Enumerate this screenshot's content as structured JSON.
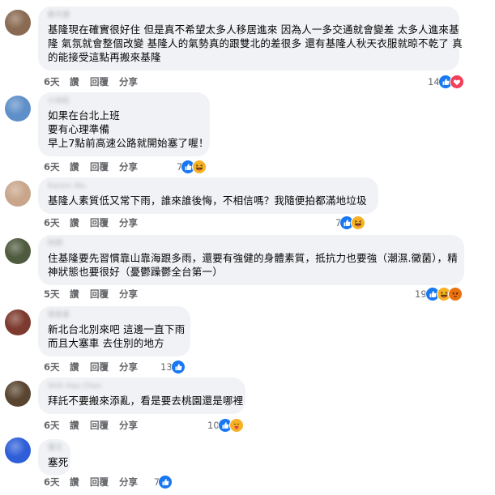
{
  "comments": [
    {
      "author": "鄭天康",
      "avatar_color": "#8a6a52",
      "lines": [
        "基隆現在確實很好住 但是真不希望太多人移居進來 因為人一多交通就會變差 太多人進來基",
        "隆 氣氛就會整個改變 基隆人的氣勢真的跟雙北的差很多 還有基隆人秋天衣服就晾不乾了 真",
        "的能接受這點再搬來基隆"
      ],
      "time": "6天",
      "like": "讚",
      "reply": "回覆",
      "share": "分享",
      "reaction_count": "14",
      "reactions": [
        "like",
        "love"
      ]
    },
    {
      "author": "小米粒",
      "avatar_color": "#5f8fc9",
      "lines": [
        "如果在台北上班",
        "要有心理準備",
        "早上7點前高速公路就開始塞了喔！"
      ],
      "time": "6天",
      "like": "讚",
      "reply": "回覆",
      "share": "分享",
      "reaction_count": "7",
      "reactions": [
        "like",
        "haha"
      ]
    },
    {
      "author": "Kasion Wu",
      "avatar_color": "#c9a68b",
      "lines": [
        "基隆人素質低又常下雨，誰來誰後悔，不相信嗎？我隨便拍都滿地垃圾"
      ],
      "time": "6天",
      "like": "讚",
      "reply": "回覆",
      "share": "分享",
      "reaction_count": "7",
      "reactions": [
        "like",
        "haha"
      ]
    },
    {
      "author": "阿明",
      "avatar_color": "#4f5b3e",
      "lines": [
        "住基隆要先習慣靠山靠海跟多雨，還要有強健的身體素質，抵抗力也要強（潮濕.黴菌），精",
        "神狀態也要很好（憂鬱躁鬱全台第一）"
      ],
      "time": "5天",
      "like": "讚",
      "reply": "回覆",
      "share": "分享",
      "reaction_count": "19",
      "reactions": [
        "like",
        "haha",
        "angry"
      ]
    },
    {
      "author": "張家豪",
      "avatar_color": "#7d3a2e",
      "lines": [
        "新北台北別來吧 這邊一直下雨",
        "而且大塞車 去住別的地方"
      ],
      "time": "6天",
      "like": "讚",
      "reply": "回覆",
      "share": "分享",
      "reaction_count": "13",
      "reactions": [
        "like"
      ]
    },
    {
      "author": "Shih Hao Chen",
      "avatar_color": "#5a4630",
      "lines": [
        "拜託不要搬來添亂，看是要去桃園還是哪裡"
      ],
      "time": "6天",
      "like": "讚",
      "reply": "回覆",
      "share": "分享",
      "reaction_count": "10",
      "reactions": [
        "like",
        "care"
      ]
    },
    {
      "author": "蕭文",
      "avatar_color": "#2f5fd8",
      "lines": [
        "塞死"
      ],
      "time": "6天",
      "like": "讚",
      "reply": "回覆",
      "share": "分享",
      "reaction_count": "7",
      "reactions": [
        "like"
      ]
    }
  ]
}
